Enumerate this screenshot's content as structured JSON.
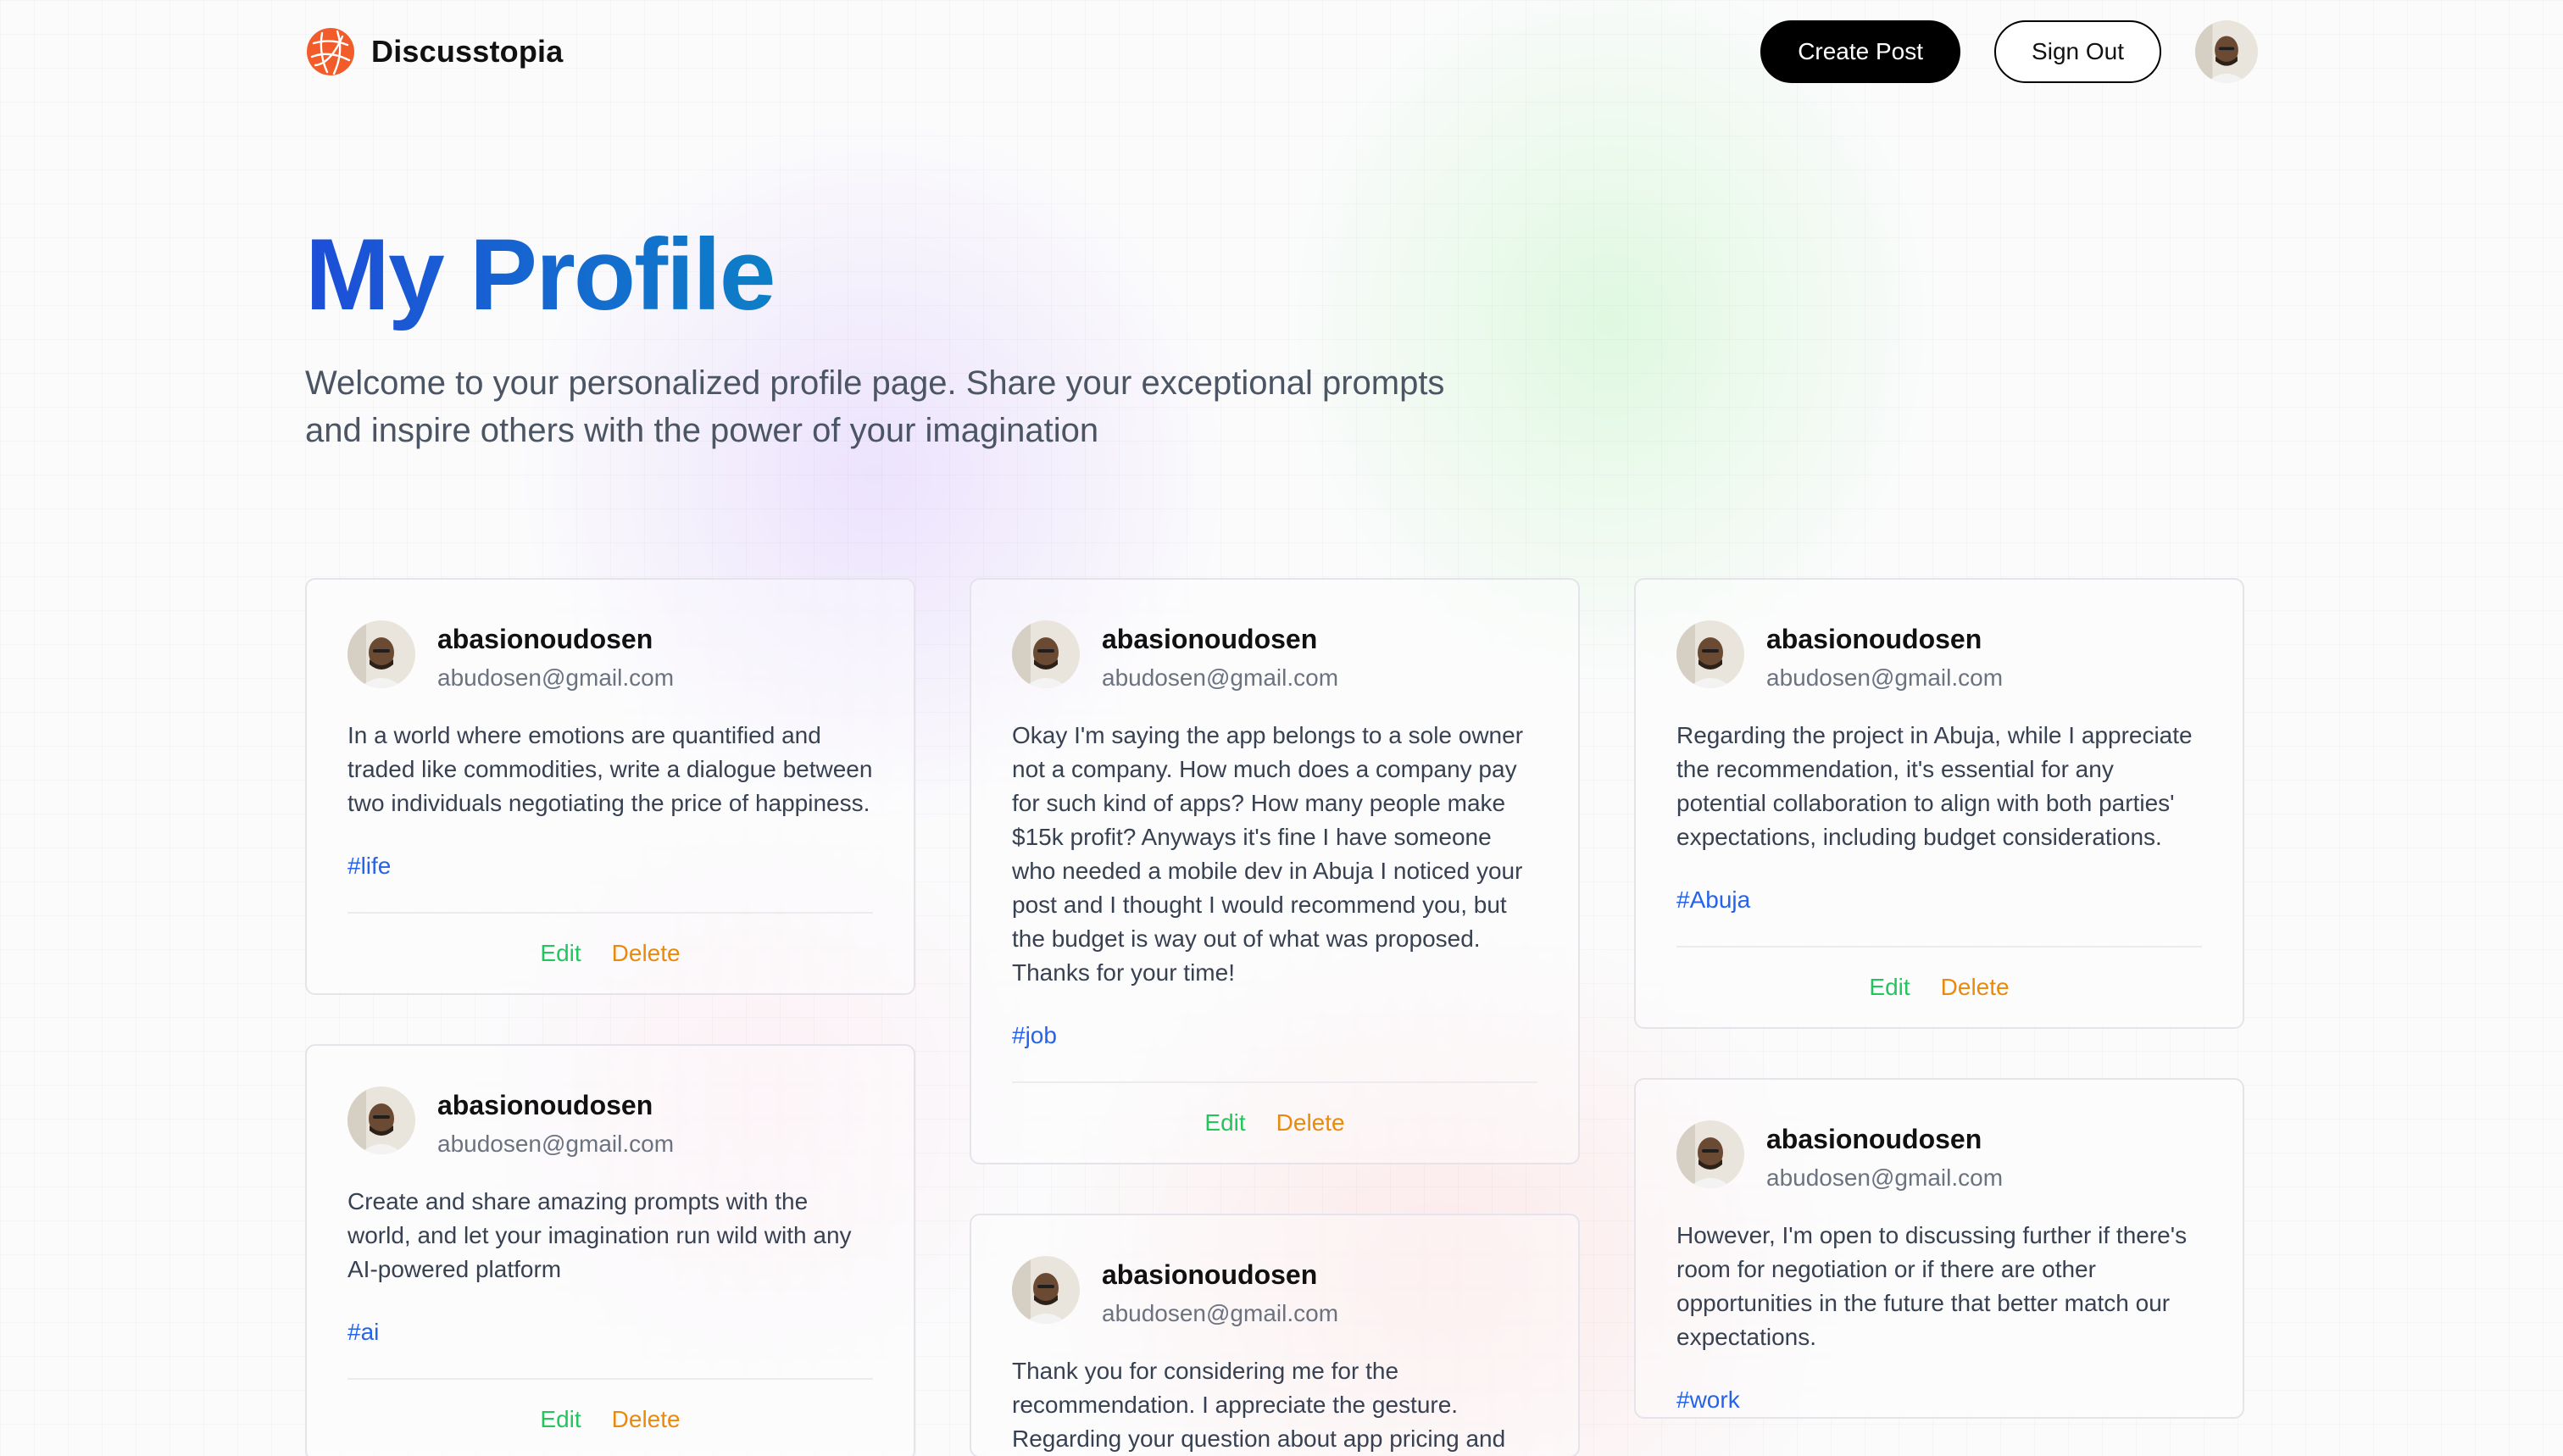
{
  "app": {
    "name": "Discusstopia",
    "brand_color": "#f25b2a"
  },
  "nav": {
    "create_post": "Create Post",
    "sign_out": "Sign Out"
  },
  "hero": {
    "title": "My Profile",
    "description": "Welcome to your personalized profile page. Share your exceptional prompts and inspire others with the power of your imagination"
  },
  "actions": {
    "edit": "Edit",
    "delete": "Delete",
    "edit_color": "#22c55e",
    "delete_color": "#ea8a0c"
  },
  "posts": [
    {
      "username": "abasionoudosen",
      "email": "abudosen@gmail.com",
      "text": "In a world where emotions are quantified and traded like commodities, write a dialogue between two individuals negotiating the price of happiness.",
      "tag": "#life"
    },
    {
      "username": "abasionoudosen",
      "email": "abudosen@gmail.com",
      "text": "Okay I'm saying the app belongs to a sole owner not a company. How much does a company pay for such kind of apps? How many people make $15k profit? Anyways it's fine I have someone who needed a mobile dev in Abuja I noticed your post and I thought I would recommend you, but the budget is way out of what was proposed. Thanks for your time!",
      "tag": "#job"
    },
    {
      "username": "abasionoudosen",
      "email": "abudosen@gmail.com",
      "text": "Regarding the project in Abuja, while I appreciate the recommendation, it's essential for any potential collaboration to align with both parties' expectations, including budget considerations.",
      "tag": "#Abuja"
    },
    {
      "username": "abasionoudosen",
      "email": "abudosen@gmail.com",
      "text": "Create and share amazing prompts with the world, and let your imagination run wild with any AI-powered platform",
      "tag": "#ai"
    },
    {
      "username": "abasionoudosen",
      "email": "abudosen@gmail.com",
      "text": "Thank you for considering me for the recommendation. I appreciate the gesture. Regarding your question about app pricing and",
      "tag": ""
    },
    {
      "username": "abasionoudosen",
      "email": "abudosen@gmail.com",
      "text": "However, I'm open to discussing further if there's room for negotiation or if there are other opportunities in the future that better match our expectations.",
      "tag": "#work"
    }
  ]
}
